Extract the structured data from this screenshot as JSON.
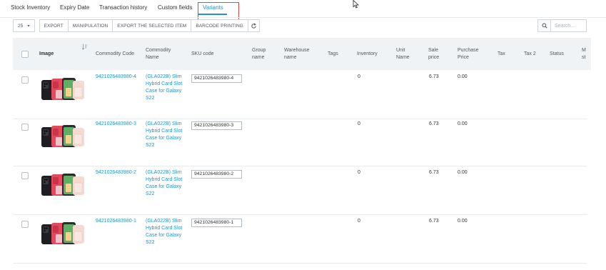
{
  "tabs": [
    {
      "label": "Stock Inventory"
    },
    {
      "label": "Expiry Date"
    },
    {
      "label": "Transaction history"
    },
    {
      "label": "Custom fields"
    },
    {
      "label": "Variants"
    }
  ],
  "active_tab": "Variants",
  "toolbar": {
    "page_size": "25",
    "page_size_caret": "▾",
    "export": "EXPORT",
    "manipulation": "MANIPULATION",
    "export_selected": "EXPORT THE SELECTED ITEM",
    "barcode_printing": "BARCODE PRINTING"
  },
  "search": {
    "placeholder": "Search..."
  },
  "columns": {
    "image": "Image",
    "commodity_code": "Commodity Code",
    "commodity_name": "Commodity Name",
    "sku_code": "SKU code",
    "group_name": "Group name",
    "warehouse_name": "Warehouse name",
    "tags": "Tags",
    "inventory": "Inventory",
    "unit_name": "Unit Name",
    "sale_price": "Sale price",
    "purchase_price": "Purchase Price",
    "tax": "Tax",
    "tax2": "Tax 2",
    "status": "Status",
    "more": "M st"
  },
  "rows": [
    {
      "code": "9421026483980-4",
      "name": "(GLA022B) Slim Hybrid Card Slot Case for Galaxy S22",
      "sku": "9421026483980-4",
      "inventory": "0",
      "sale_price": "6.73",
      "purchase_price": "0.00"
    },
    {
      "code": "9421026483980-3",
      "name": "(GLA022B) Slim Hybrid Card Slot Case for Galaxy S22",
      "sku": "9421026483980-3",
      "inventory": "0",
      "sale_price": "6.73",
      "purchase_price": "0.00"
    },
    {
      "code": "9421026483980-2",
      "name": "(GLA022B) Slim Hybrid Card Slot Case for Galaxy S22",
      "sku": "9421026483980-2",
      "inventory": "0",
      "sale_price": "6.73",
      "purchase_price": "0.00"
    },
    {
      "code": "9421026483980-1",
      "name": "(GLA022B) Slim Hybrid Card Slot Case for Galaxy S22",
      "sku": "9421026483980-1",
      "inventory": "0",
      "sale_price": "6.73",
      "purchase_price": "0.00"
    }
  ],
  "colors": {
    "accent": "#2196c9",
    "highlight": "#e0463a",
    "header_bg": "#f0f3f6"
  }
}
